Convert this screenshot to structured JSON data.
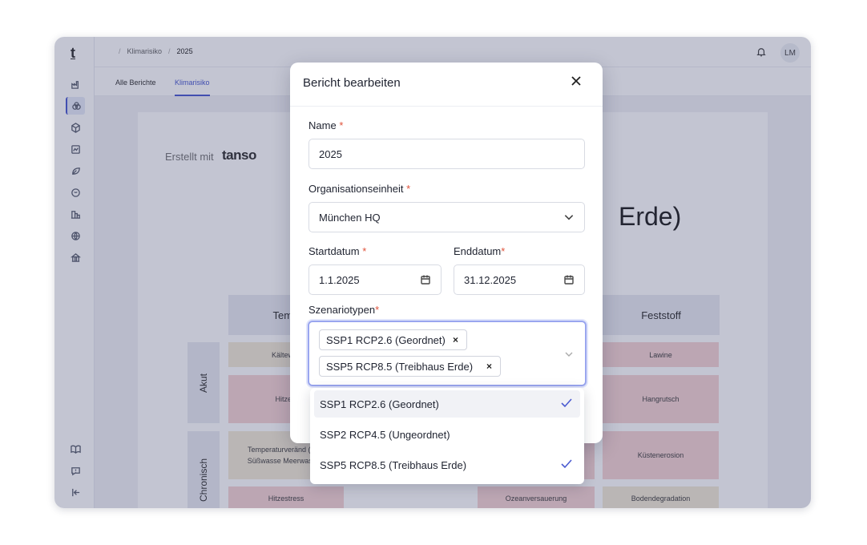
{
  "sidebar": {
    "logo": "t"
  },
  "breadcrumb": {
    "parent": "Klimarisiko",
    "current": "2025",
    "separator": "/"
  },
  "header": {
    "avatar": "LM"
  },
  "tabs": [
    {
      "label": "Alle Berichte"
    },
    {
      "label": "Klimarisiko"
    }
  ],
  "report": {
    "created_with": "Erstellt mit",
    "brand": "tanso",
    "title_fragment": "Erde)",
    "columns": [
      {
        "label": "Tempe"
      },
      {
        "label": "Feststoff"
      }
    ],
    "rows": [
      {
        "label": "Akut"
      },
      {
        "label": "Chronisch"
      }
    ],
    "cells": {
      "kaltewelle": "Kältewell",
      "hitzewelle": "Hitzew",
      "temperatur": "Temperaturveränd (Luft, Süßwasse Meerwasser)",
      "hitzestress": "Hitzestress",
      "lawine": "Lawine",
      "hangrutsch": "Hangrutsch",
      "kuestenerosion": "Küstenerosion",
      "ozean": "Ozeanversauerung",
      "boden": "Bodendegradation"
    }
  },
  "modal": {
    "title": "Bericht bearbeiten",
    "name_label": "Name",
    "name_value": "2025",
    "org_label": "Organisationseinheit",
    "org_value": "München HQ",
    "start_label": "Startdatum",
    "start_value": "1.1.2025",
    "end_label": "Enddatum",
    "end_value": "31.12.2025",
    "scenario_label": "Szenariotypen",
    "required_mark": "*",
    "selected_chips": [
      {
        "label": "SSP1 RCP2.6 (Geordnet)"
      },
      {
        "label": "SSP5 RCP8.5 (Treibhaus Erde)"
      }
    ],
    "chip_remove": "×",
    "options": [
      {
        "label": "SSP1 RCP2.6 (Geordnet)",
        "selected": true
      },
      {
        "label": "SSP2 RCP4.5 (Ungeordnet)",
        "selected": false
      },
      {
        "label": "SSP5 RCP8.5 (Treibhaus Erde)",
        "selected": true
      }
    ]
  },
  "colors": {
    "accent": "#4b5bd0",
    "required": "#e0533b",
    "risk_high": "#f6d4d4",
    "risk_medium": "#f3ead7"
  }
}
